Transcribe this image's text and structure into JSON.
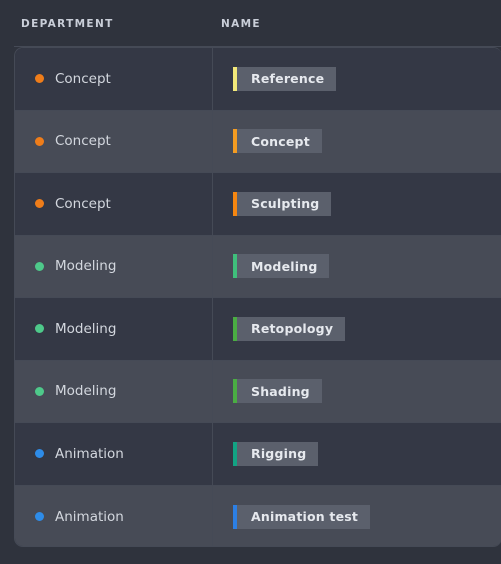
{
  "table": {
    "columns": [
      {
        "key": "department",
        "label": "DEPARTMENT"
      },
      {
        "key": "name",
        "label": "NAME"
      }
    ],
    "rows": [
      {
        "department": "Concept",
        "dept_color": "#ef7d1a",
        "name": "Reference",
        "tag_color": "#f3e97a"
      },
      {
        "department": "Concept",
        "dept_color": "#ef7d1a",
        "name": "Concept",
        "tag_color": "#f39c22"
      },
      {
        "department": "Concept",
        "dept_color": "#ef7d1a",
        "name": "Sculpting",
        "tag_color": "#f58610"
      },
      {
        "department": "Modeling",
        "dept_color": "#4ec98a",
        "name": "Modeling",
        "tag_color": "#3fbf7b"
      },
      {
        "department": "Modeling",
        "dept_color": "#4ec98a",
        "name": "Retopology",
        "tag_color": "#4aad43"
      },
      {
        "department": "Modeling",
        "dept_color": "#4ec98a",
        "name": "Shading",
        "tag_color": "#4aad43"
      },
      {
        "department": "Animation",
        "dept_color": "#2e8ce8",
        "name": "Rigging",
        "tag_color": "#12a383"
      },
      {
        "department": "Animation",
        "dept_color": "#2e8ce8",
        "name": "Animation test",
        "tag_color": "#2c7fe4"
      }
    ]
  }
}
